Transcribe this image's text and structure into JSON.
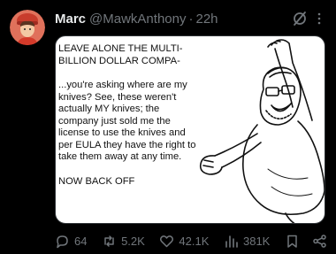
{
  "post": {
    "author_name": "Marc",
    "handle": "@MawkAnthony",
    "separator": "·",
    "time": "22h"
  },
  "meme": {
    "line1": "LEAVE ALONE THE MULTI-BILLION DOLLAR COMPA-",
    "line2": "...you're asking where are my knives? See, these weren't actually MY knives; the company just sold me the license to use the knives and per EULA they have the right to take them away at any time.",
    "line3": "NOW BACK OFF"
  },
  "actions": {
    "replies": "64",
    "reposts": "5.2K",
    "likes": "42.1K",
    "views": "381K"
  },
  "icons": {
    "grok": "grok-icon",
    "more": "more-icon",
    "reply": "reply-icon",
    "repost": "repost-icon",
    "like": "heart-icon",
    "views": "views-icon",
    "bookmark": "bookmark-icon",
    "share": "share-icon"
  },
  "colors": {
    "background": "#000000",
    "primary_text": "#e7e9ea",
    "secondary_text": "#71767b",
    "avatar_bg": "#e0715b"
  }
}
